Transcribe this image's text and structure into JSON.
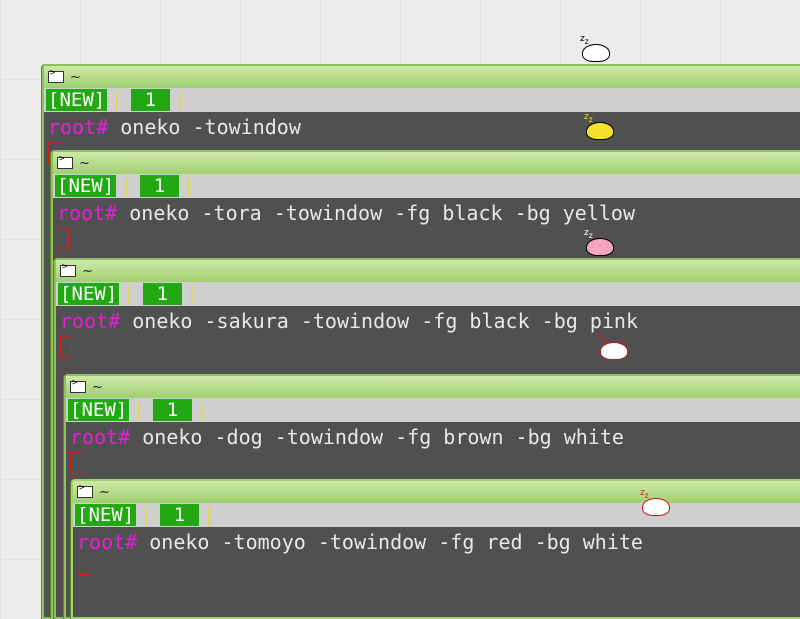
{
  "windows": [
    {
      "title": "~",
      "tab_new": "[NEW]",
      "tab_num": "1",
      "prompt": "root#",
      "command": "oneko -towindow"
    },
    {
      "title": "~",
      "tab_new": "[NEW]",
      "tab_num": "1",
      "prompt": "root#",
      "command": "oneko -tora -towindow -fg black -bg yellow"
    },
    {
      "title": "~",
      "tab_new": "[NEW]",
      "tab_num": "1",
      "prompt": "root#",
      "command": "oneko -sakura -towindow -fg black -bg pink"
    },
    {
      "title": "~",
      "tab_new": "[NEW]",
      "tab_num": "1",
      "prompt": "root#",
      "command": "oneko -dog -towindow -fg brown -bg white"
    },
    {
      "title": "~",
      "tab_new": "[NEW]",
      "tab_num": "1",
      "prompt": "root#",
      "command": "oneko -tomoyo -towindow -fg red -bg white"
    }
  ],
  "colors": {
    "titlebar": "#9fd070",
    "tab_active": "#22a812",
    "prompt": "#e61ed8",
    "terminal_bg": "#505050",
    "cursor": "#d02020"
  },
  "sprites": [
    {
      "name": "sleeping-cat-white-icon",
      "label": "z z"
    },
    {
      "name": "sleeping-cat-yellow-icon",
      "label": "z z"
    },
    {
      "name": "sleeping-cat-pink-icon",
      "label": "z z"
    },
    {
      "name": "sleeping-dog-red-icon",
      "label": "z z"
    },
    {
      "name": "sleeping-character-red-icon",
      "label": "z z"
    }
  ]
}
